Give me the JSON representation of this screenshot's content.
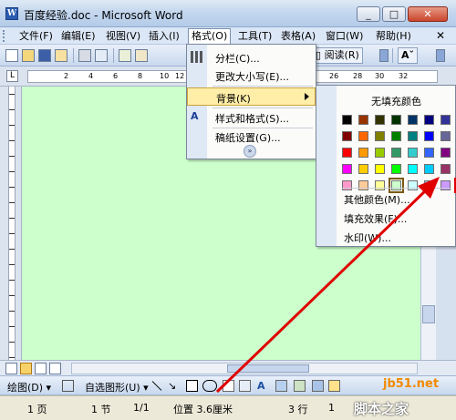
{
  "window": {
    "title": "百度经验.doc - Microsoft Word",
    "minimize": "_",
    "maximize": "□",
    "close": "✕"
  },
  "menubar": {
    "items": [
      "文件(F)",
      "编辑(E)",
      "视图(V)",
      "插入(I)",
      "格式(O)",
      "工具(T)",
      "表格(A)",
      "窗口(W)",
      "帮助(H)"
    ],
    "active_index": 4,
    "close_doc": "✕"
  },
  "toolbar": {
    "reading_mode": "阅读(R)",
    "font_size_label": "A"
  },
  "ruler": {
    "corner": "L",
    "ticks": [
      "2",
      "4",
      "6",
      "8",
      "10",
      "12",
      "26",
      "28",
      "30",
      "32"
    ]
  },
  "format_menu": {
    "items": [
      {
        "label": "分栏(C)...",
        "icon": "columns-icon"
      },
      {
        "label": "更改大小写(E)...",
        "icon": ""
      },
      {
        "label": "背景(K)",
        "icon": "",
        "has_submenu": true,
        "highlighted": true
      },
      {
        "label": "样式和格式(S)...",
        "icon": "styles-icon"
      },
      {
        "label": "稿纸设置(G)...",
        "icon": ""
      }
    ],
    "expand": "»"
  },
  "color_menu": {
    "no_fill": "无填充颜色",
    "more_colors": "其他颜色(M)...",
    "fill_effects": "填充效果(F)...",
    "watermark": "水印(W)...",
    "swatch_rows": [
      [
        "#000000",
        "#993300",
        "#333300",
        "#003300",
        "#003366",
        "#000080",
        "#333399",
        "#333333"
      ],
      [
        "#800000",
        "#ff6600",
        "#808000",
        "#008000",
        "#008080",
        "#0000ff",
        "#666699",
        "#808080"
      ],
      [
        "#ff0000",
        "#ff9900",
        "#99cc00",
        "#339966",
        "#33cccc",
        "#3366ff",
        "#800080",
        "#999999"
      ],
      [
        "#ff00ff",
        "#ffcc00",
        "#ffff00",
        "#00ff00",
        "#00ffff",
        "#00ccff",
        "#993366",
        "#c0c0c0"
      ],
      [
        "#ff99cc",
        "#ffcc99",
        "#ffff99",
        "#ccffcc",
        "#ccffff",
        "#99ccff",
        "#cc99ff",
        "#ffffff"
      ]
    ],
    "selected": [
      4,
      3
    ],
    "target": [
      4,
      7
    ]
  },
  "drawbar": {
    "draw_label": "绘图(D)",
    "autoshapes_label": "自选图形(U)"
  },
  "statusbar": {
    "page": "1 页",
    "section": "1 节",
    "page_of": "1/1",
    "position": "位置 3.6厘米",
    "line": "3 行",
    "column": "1"
  },
  "watermark": {
    "site": "jb51.net",
    "name": "脚本之家"
  },
  "colors": {
    "doc_background": "#ccffcc",
    "arrow": "#e00000",
    "menu_highlight": "#ffeea8"
  }
}
